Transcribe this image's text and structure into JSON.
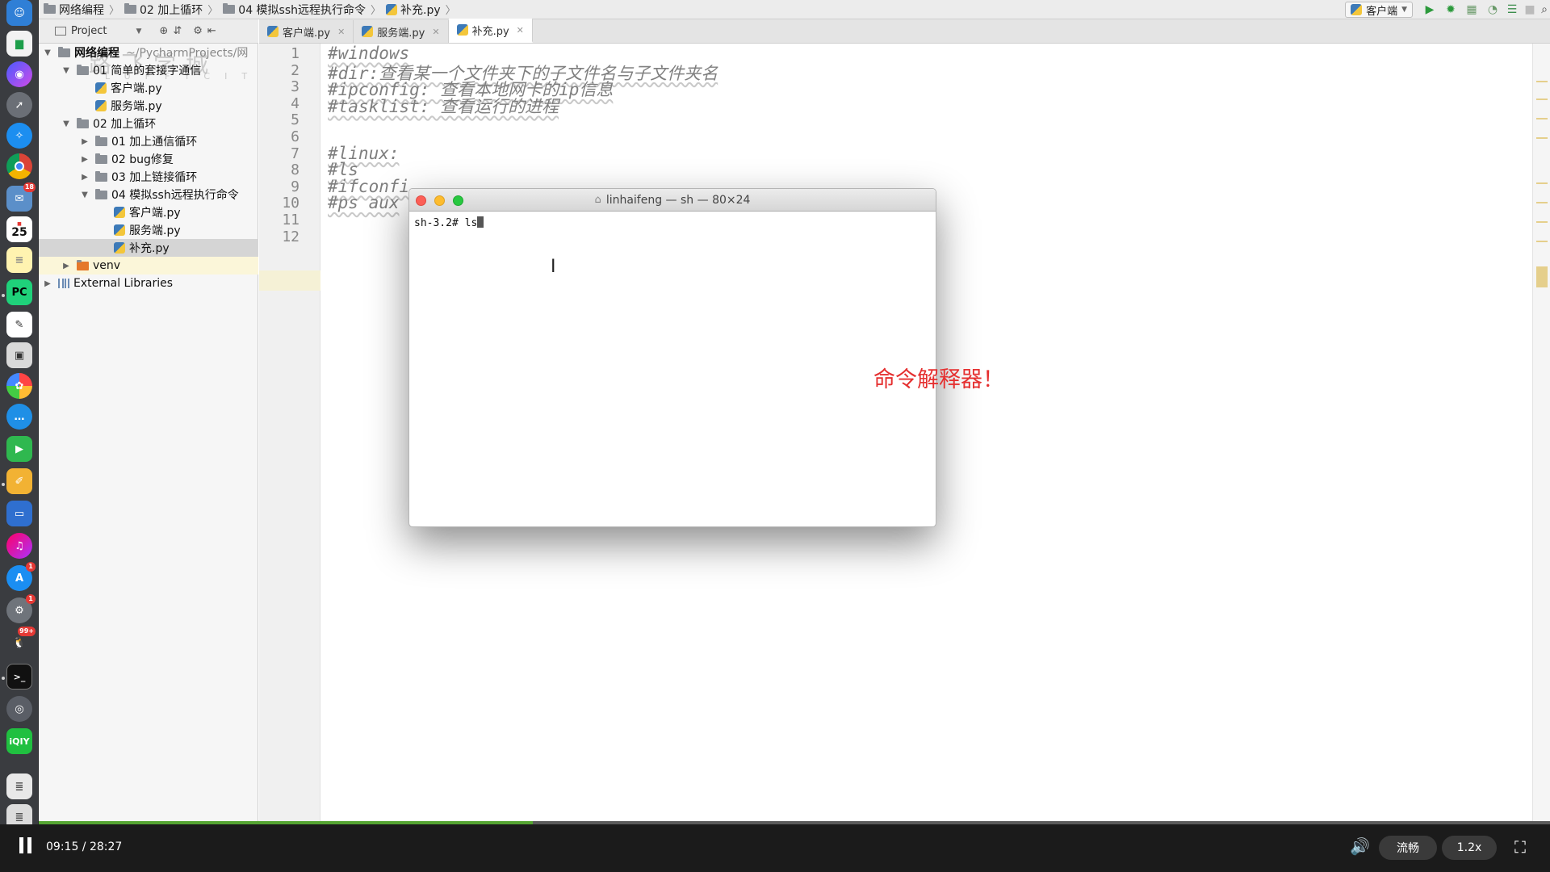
{
  "breadcrumb": [
    "网络编程",
    "02 加上循环",
    "04 模拟ssh远程执行命令",
    "补充.py"
  ],
  "toolbar": {
    "run_config": "客户端"
  },
  "project_toolbar": {
    "label": "Project"
  },
  "watermark": {
    "main": "路飞学城",
    "sub": "LUFFYCITY"
  },
  "tree": [
    {
      "label": "网络编程",
      "suffix": "~/PycharmProjects/网",
      "arrow": "▼",
      "type": "folder",
      "depth": 0,
      "bold": true
    },
    {
      "label": "01 简单的套接字通信",
      "arrow": "▼",
      "type": "folder",
      "depth": 1
    },
    {
      "label": "客户端.py",
      "arrow": "",
      "type": "py",
      "depth": 2
    },
    {
      "label": "服务端.py",
      "arrow": "",
      "type": "py",
      "depth": 2
    },
    {
      "label": "02 加上循环",
      "arrow": "▼",
      "type": "folder",
      "depth": 1
    },
    {
      "label": "01 加上通信循环",
      "arrow": "▶",
      "type": "folder",
      "depth": 2
    },
    {
      "label": "02 bug修复",
      "arrow": "▶",
      "type": "folder",
      "depth": 2
    },
    {
      "label": "03 加上链接循环",
      "arrow": "▶",
      "type": "folder",
      "depth": 2
    },
    {
      "label": "04 模拟ssh远程执行命令",
      "arrow": "▼",
      "type": "folder",
      "depth": 2
    },
    {
      "label": "客户端.py",
      "arrow": "",
      "type": "py",
      "depth": 3
    },
    {
      "label": "服务端.py",
      "arrow": "",
      "type": "py",
      "depth": 3
    },
    {
      "label": "补充.py",
      "arrow": "",
      "type": "py",
      "depth": 3,
      "selected": true
    },
    {
      "label": "venv",
      "arrow": "▶",
      "type": "venv",
      "depth": 1,
      "highlight": true
    },
    {
      "label": "External Libraries",
      "arrow": "▶",
      "type": "lib",
      "depth": 0
    }
  ],
  "tabs": [
    {
      "label": "客户端.py",
      "active": false
    },
    {
      "label": "服务端.py",
      "active": false
    },
    {
      "label": "补充.py",
      "active": true
    }
  ],
  "editor": {
    "line_numbers": [
      "1",
      "2",
      "3",
      "4",
      "5",
      "6",
      "7",
      "8",
      "9",
      "10",
      "11",
      "12"
    ],
    "lines": [
      "#windows",
      "#dir:查看某一个文件夹下的子文件名与子文件夹名",
      "#ipconfig: 查看本地网卡的ip信息",
      "#tasklist: 查看运行的进程",
      "",
      "",
      "#linux:",
      "#ls",
      "#ifconfi",
      "#ps aux",
      "",
      ""
    ]
  },
  "terminal": {
    "title": "linhaifeng — sh — 80×24",
    "prompt": "sh-3.2# ls"
  },
  "annotation": "命令解释器！",
  "player": {
    "time": "09:15 / 28:27",
    "progress": 0.3267,
    "quality": "流畅",
    "speed": "1.2x"
  },
  "dock": {
    "calendar_day": "25",
    "badges": {
      "mail": "18",
      "appstore": "1",
      "prefs": "1",
      "qq": "99+"
    }
  },
  "colors": {
    "accent_green": "#55a532",
    "annotation_red": "#e53030"
  }
}
